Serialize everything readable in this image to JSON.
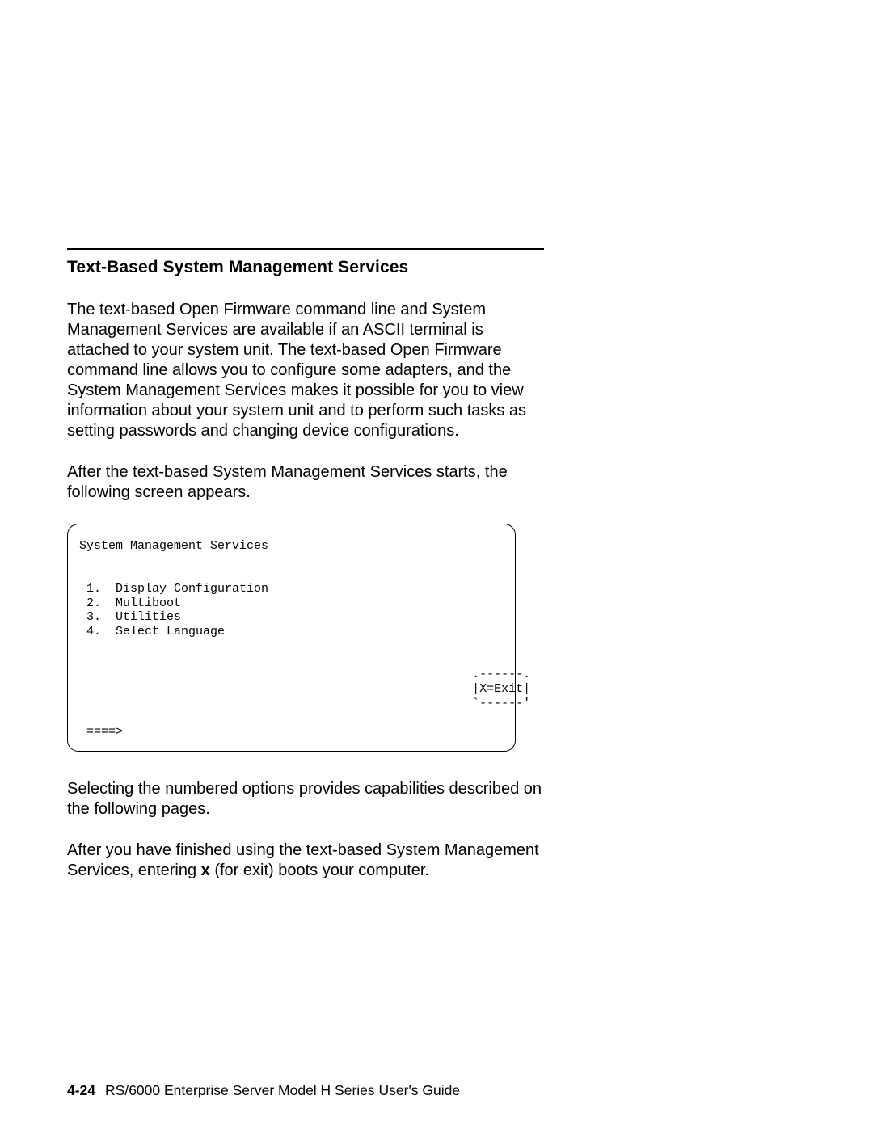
{
  "heading": "Text-Based System Management Services",
  "para1": "The text-based Open Firmware command line and System Management Services are available if an ASCII terminal is attached to your system unit. The text-based Open Firmware command line allows you to configure some adapters, and the System Management Services makes it possible for you to view information about your system unit and to perform such tasks as setting passwords and changing device configurations.",
  "para2": "After the text-based System Management Services starts, the following screen appears.",
  "terminal": {
    "title": "System Management Services",
    "options": [
      "1.  Display Configuration",
      "2.  Multiboot",
      "3.  Utilities",
      "4.  Select Language"
    ],
    "exit_top": "                                                      .------.",
    "exit_mid": "                                                      |X=Exit|",
    "exit_bot": "                                                      `------'",
    "prompt": " ====>"
  },
  "para3": "Selecting the numbered options provides capabilities described on the following pages.",
  "para4_pre": "After you have finished using the text-based System Management Services, entering ",
  "para4_bold": "x",
  "para4_post": " (for exit) boots your computer.",
  "footer": {
    "pageno": "4-24",
    "book": "RS/6000 Enterprise Server Model H Series User's Guide"
  }
}
